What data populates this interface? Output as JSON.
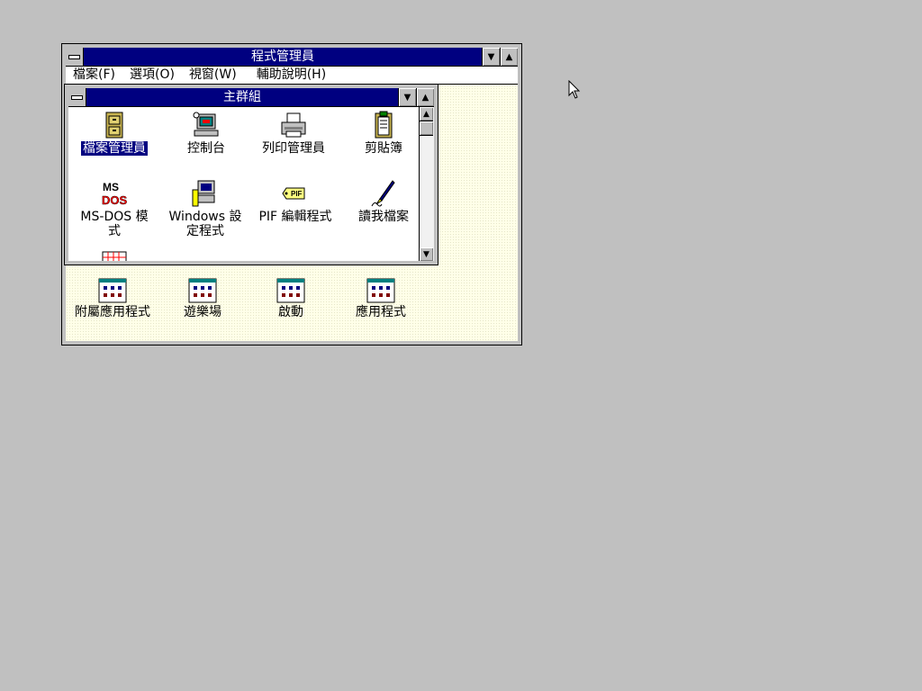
{
  "program_manager": {
    "title": "程式管理員",
    "menu": [
      "檔案(F)",
      "選項(O)",
      "視窗(W)",
      "輔助說明(H)"
    ]
  },
  "main_group": {
    "title": "主群組",
    "items": [
      {
        "label": "檔案管理員",
        "icon": "file-cabinet-icon",
        "selected": true
      },
      {
        "label": "控制台",
        "icon": "control-panel-icon"
      },
      {
        "label": "列印管理員",
        "icon": "printer-icon"
      },
      {
        "label": "剪貼簿",
        "icon": "clipboard-icon"
      },
      {
        "label": "MS-DOS 模式",
        "icon": "ms-dos-icon"
      },
      {
        "label": "Windows 設定程式",
        "label_line1": "Windows 設",
        "label_line2": "定程式",
        "icon": "windows-setup-icon"
      },
      {
        "label": "PIF 編輯程式",
        "icon": "pif-editor-icon"
      },
      {
        "label": "讀我檔案",
        "icon": "readme-icon"
      }
    ]
  },
  "minimized_groups": [
    {
      "label": "附屬應用程式",
      "icon": "program-group-icon"
    },
    {
      "label": "遊樂場",
      "icon": "program-group-icon"
    },
    {
      "label": "啟動",
      "icon": "program-group-icon"
    },
    {
      "label": "應用程式",
      "icon": "program-group-icon"
    }
  ],
  "colors": {
    "titlebar": "#000080",
    "desktop": "#c0c0c0",
    "workspace": "#ffffe8"
  }
}
